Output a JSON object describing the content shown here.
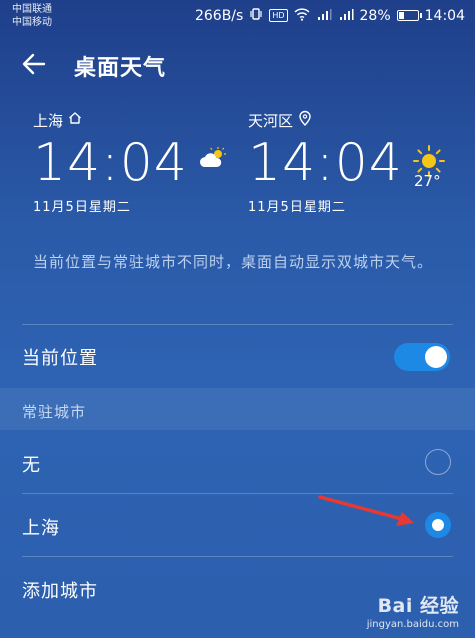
{
  "status_bar": {
    "carrier1": "中国联通",
    "carrier2": "中国移动",
    "speed": "266B/s",
    "hd": "HD",
    "battery": "28%",
    "battery_level": 0.28,
    "time": "14:04"
  },
  "header": {
    "title": "桌面天气"
  },
  "widget": {
    "left": {
      "city": "上海",
      "time": "14:04",
      "date": "11月5日星期二"
    },
    "right": {
      "city": "天河区",
      "time": "14:04",
      "date": "11月5日星期二",
      "temperature": "27°"
    }
  },
  "description": "当前位置与常驻城市不同时，桌面自动显示双城市天气。",
  "current_location": {
    "label": "当前位置",
    "enabled": true
  },
  "resident": {
    "section_label": "常驻城市",
    "options": [
      {
        "label": "无",
        "selected": false
      },
      {
        "label": "上海",
        "selected": true
      }
    ],
    "add_label": "添加城市"
  },
  "watermark": {
    "logo": "Bai 经验",
    "url": "jingyan.baidu.com"
  },
  "colors": {
    "accent": "#1e88e5",
    "annotation_arrow": "#e53935"
  }
}
